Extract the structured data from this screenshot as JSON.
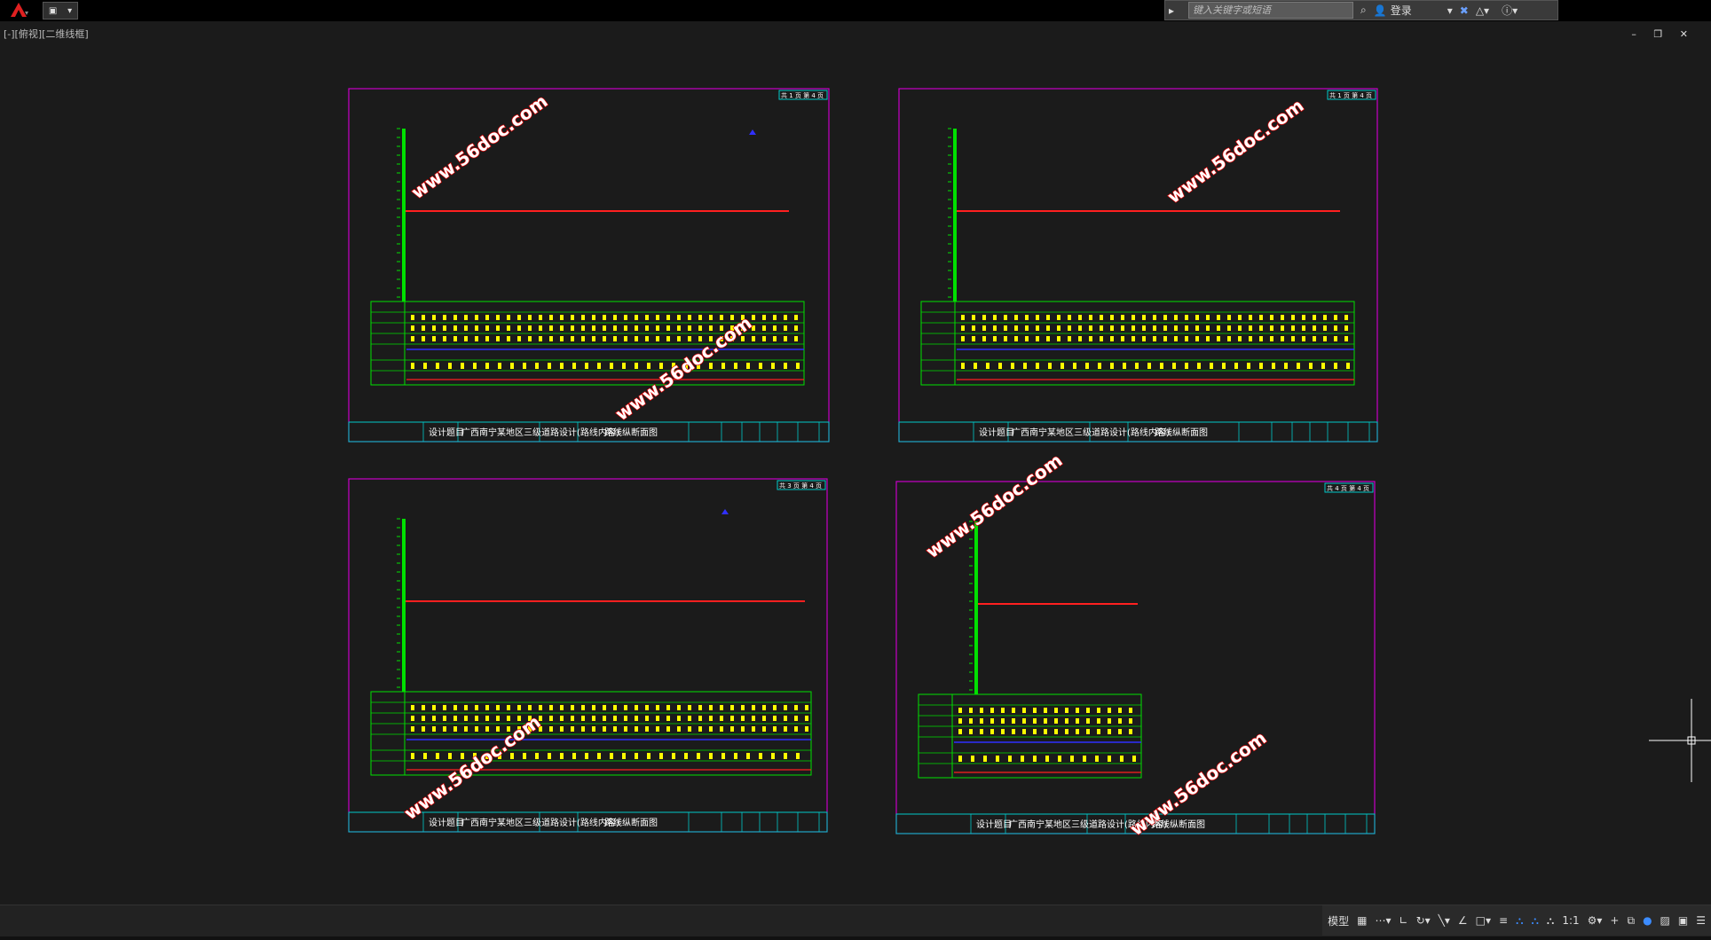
{
  "app": {
    "view_label": "[-][俯视][二维线框]",
    "search_placeholder": "键入关键字或短语",
    "login_label": "登录",
    "window_controls": "– ❐ ✕"
  },
  "icons": {
    "app_menu": "autocad-logo-icon",
    "search": "binoculars-icon",
    "user": "user-icon",
    "exchange": "exchange-icon",
    "help": "help-icon",
    "crosshair": "cursor-crosshair-icon"
  },
  "status_bar": {
    "model_label": "模型",
    "scale_label": "1:1"
  },
  "sheets": [
    {
      "page_label": "共 1 页 第 4 页",
      "title_label": "设计题目",
      "project": "广西南宁某地区三级道路设计(路线内容)",
      "drawing_name": "路线纵断面图",
      "watermark": "www.56doc.com"
    },
    {
      "page_label": "共 1 页 第 4 页",
      "title_label": "设计题目",
      "project": "广西南宁某地区三级道路设计(路线内容)",
      "drawing_name": "路线纵断面图",
      "watermark": "www.56doc.com"
    },
    {
      "page_label": "共 3 页 第 4 页",
      "title_label": "设计题目",
      "project": "广西南宁某地区三级道路设计(路线内容)",
      "drawing_name": "路线纵断面图",
      "watermark": "www.56doc.com"
    },
    {
      "page_label": "共 4 页 第 4 页",
      "title_label": "设计题目",
      "project": "广西南宁某地区三级道路设计(路线内容)",
      "drawing_name": "路线纵断面图",
      "watermark": "www.56doc.com"
    }
  ],
  "colors": {
    "frame": "#c800c8",
    "grid": "#00e000",
    "profile": "#ff2020",
    "tables": "#ffff00",
    "titleblock": "#00c8c8",
    "design_line": "#3030ff"
  }
}
